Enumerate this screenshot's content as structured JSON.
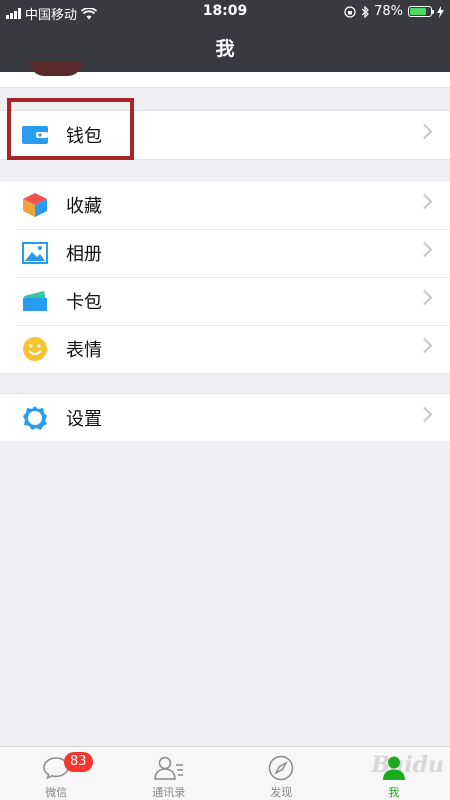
{
  "status_bar": {
    "carrier": "中国移动",
    "time": "18:09",
    "battery_text": "78%",
    "battery_level": 0.78,
    "icons": [
      "signal-icon",
      "wifi-icon",
      "orientation-lock-icon",
      "bluetooth-icon",
      "battery-icon",
      "charging-icon"
    ]
  },
  "nav": {
    "title": "我"
  },
  "groups": [
    [
      {
        "label": "钱包",
        "icon": "wallet-icon",
        "color": "#2a9cf0"
      }
    ],
    [
      {
        "label": "收藏",
        "icon": "favorites-cube-icon",
        "color": "#f4a33a"
      },
      {
        "label": "相册",
        "icon": "photo-album-icon",
        "color": "#2a9cf0"
      },
      {
        "label": "卡包",
        "icon": "card-wallet-icon",
        "color": "#37c6a0"
      },
      {
        "label": "表情",
        "icon": "smiley-icon",
        "color": "#f7c431"
      }
    ],
    [
      {
        "label": "设置",
        "icon": "settings-gear-icon",
        "color": "#2a9cf0"
      }
    ]
  ],
  "tabbar": {
    "tabs": [
      {
        "label": "微信",
        "icon": "chat-bubble-icon",
        "badge": "83"
      },
      {
        "label": "通讯录",
        "icon": "contacts-icon"
      },
      {
        "label": "发现",
        "icon": "compass-icon"
      },
      {
        "label": "我",
        "icon": "me-person-icon",
        "active": true
      }
    ]
  },
  "watermark": "Baidu"
}
